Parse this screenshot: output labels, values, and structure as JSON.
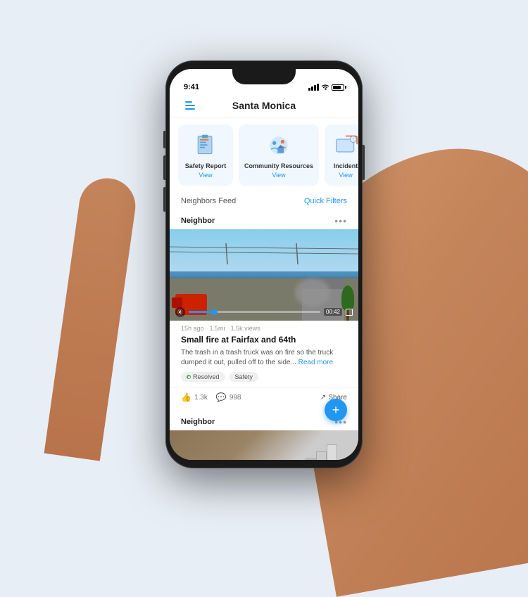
{
  "scene": {
    "bg_color": "#e8eef5"
  },
  "status_bar": {
    "time": "9:41"
  },
  "header": {
    "menu_label": "menu",
    "title": "Santa Monica"
  },
  "cards": [
    {
      "id": "safety-report",
      "label": "Safety Report",
      "link_text": "View"
    },
    {
      "id": "community-resources",
      "label": "Community Resources",
      "link_text": "View"
    },
    {
      "id": "incidents",
      "label": "Incident",
      "link_text": "View"
    }
  ],
  "feed": {
    "title": "Neighbors Feed",
    "quick_filters_label": "Quick Filters"
  },
  "post": {
    "author": "Neighbor",
    "more_icon": "•••",
    "video_time": "00:42",
    "meta_time": "15h ago",
    "meta_distance": "1.5mi",
    "meta_views": "1.5k views",
    "title": "Small fire at Fairfax and 64th",
    "description": "The trash in a trash truck was on fire so the truck dumped it out, pulled off to the side...",
    "read_more": "Read more",
    "tags": [
      {
        "label": "Resolved",
        "color": "#4CAF50"
      },
      {
        "label": "Safety",
        "color": null
      }
    ],
    "likes": "1.3k",
    "comments": "998",
    "share_label": "Share"
  },
  "fab": {
    "label": "+"
  },
  "post2": {
    "author": "Neighbor",
    "more_icon": "•••"
  }
}
